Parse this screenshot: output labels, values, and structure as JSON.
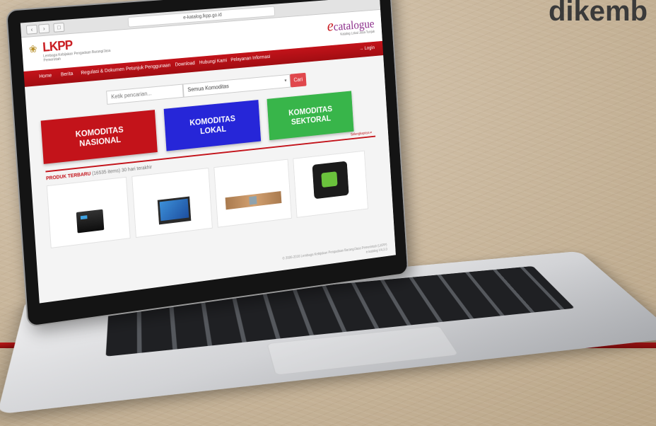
{
  "slide": {
    "title": "dikemb"
  },
  "browser": {
    "url": "e-katalog.lkpp.go.id"
  },
  "site": {
    "logo": "LKPP",
    "logo_subtitle": "Lembaga Kebijakan Pengadaan Barang/Jasa Pemerintah",
    "brand": "catalogue",
    "brand_subtitle": "Katalog Lokal Jasa Tunjuk",
    "login": "→ Login"
  },
  "nav": {
    "items": [
      "Home",
      "Berita",
      "Regulasi & Dokumen",
      "Petunjuk Penggunaan",
      "Download",
      "Hubungi Kami",
      "Pelayanan Informasi"
    ]
  },
  "search": {
    "placeholder": "Ketik pencarian...",
    "category": "Semua Komoditas",
    "button": "Cari"
  },
  "tiles": {
    "nasional": "KOMODITAS\nNASIONAL",
    "lokal": "KOMODITAS\nLOKAL",
    "sektoral": "KOMODITAS\nSEKTORAL",
    "more": "Selengkapnya ▾"
  },
  "products": {
    "heading": "PRODUK TERBARU",
    "note": "(16535 items) 30 hari terakhir"
  },
  "footer": {
    "copyright": "© 2006-2016 Lembaga Kebijakan Pengadaan Barang/Jasa Pemerintah (LKPP)",
    "version": "e-katalog V4.3.0"
  },
  "colors": {
    "brand_red": "#c3131a",
    "tile_blue": "#2626d8",
    "tile_green": "#38b54a"
  }
}
